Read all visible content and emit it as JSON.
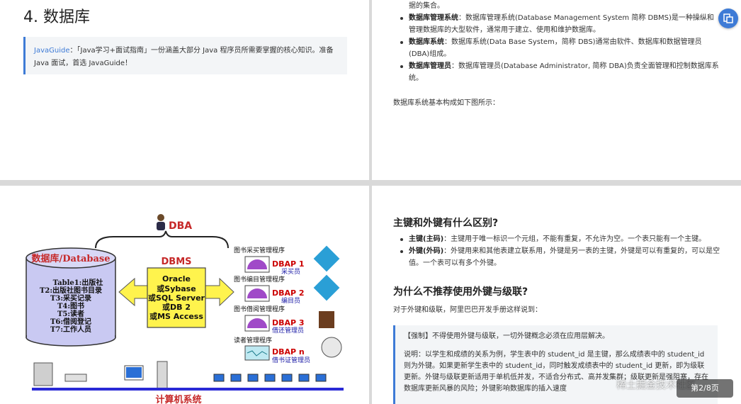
{
  "page1": {
    "title": "4. 数据库",
    "tip_link": "JavaGuide",
    "tip_text": "：「Java学习+面试指南」一份涵盖大部分 Java 程序员所需要掌握的核心知识。准备 Java 面试，首选 JavaGuide！"
  },
  "page2": {
    "top_fragment": "据的集合。",
    "items": [
      {
        "term": "数据库管理系统",
        "text": "：数据库管理系统(Database Management System 简称 DBMS)是一种操纵和管理数据库的大型软件，通常用于建立、使用和维护数据库。"
      },
      {
        "term": "数据库系统",
        "text": "：数据库系统(Data Base System，简称 DBS)通常由软件、数据库和数据管理员(DBA)组成。"
      },
      {
        "term": "数据库管理员",
        "text": "：数据库管理员(Database Administrator, 简称 DBA)负责全面管理和控制数据库系统。"
      }
    ],
    "footer_text": "数据库系统基本构成如下图所示："
  },
  "diagram": {
    "dba_label": "DBA",
    "db_title": "数据库/Database",
    "tables": [
      "Table1:出版社",
      "T2:出版社图书目录",
      "T3:采买记录",
      "T4:图书",
      "T5:读者",
      "T6:借阅登记",
      "T7:工作人员"
    ],
    "dbms_label": "DBMS",
    "dbms_items": [
      "Oracle",
      "或Sybase",
      "或SQL Server",
      "或DB 2",
      "或MS Access"
    ],
    "apps": [
      {
        "program": "图书采买管理程序",
        "name": "DBAP 1",
        "role": "采买员"
      },
      {
        "program": "图书编目管理程序",
        "name": "DBAP 2",
        "role": "编目员"
      },
      {
        "program": "图书借阅管理程序",
        "name": "DBAP 3",
        "role": "借还管理员"
      },
      {
        "program": "读者管理程序",
        "name": "DBAP n",
        "role": "借书证管理员"
      }
    ],
    "bottom_label": "计算机系统"
  },
  "page4": {
    "heading1": "主键和外键有什么区别?",
    "items": [
      {
        "term": "主键(主码)",
        "text": "：主键用于唯一标识一个元组，不能有重复，不允许为空。一个表只能有一个主键。"
      },
      {
        "term": "外键(外码)",
        "text": "：外键用来和其他表建立联系用，外键是另一表的主键，外键是可以有重复的，可以是空值。一个表可以有多个外键。"
      }
    ],
    "heading2": "为什么不推荐使用外键与级联?",
    "intro": "对于外键和级联，阿里巴巴开发手册这样说到：",
    "quote_p1": "【强制】不得使用外键与级联，一切外键概念必须在应用层解决。",
    "quote_p2": "说明：以学生和成绩的关系为例，学生表中的 student_id 是主键，那么成绩表中的 student_id 则为外键。如果更新学生表中的 student_id，同时触发成绩表中的 student_id 更新，即为级联更新。外键与级联更新适用于单机低并发，不适合分布式、高并发集群；级联更新是强阻塞，存在数据库更新风暴的风险；外键影响数据库的插入速度"
  },
  "overlay": {
    "watermark": "稀土掘金技术社区",
    "page_badge": "第2/8页"
  },
  "colors": {
    "accent": "#3e7bd6",
    "dbms_box": "#fff34d",
    "db_cylinder": "#c9c9f2",
    "dbap_text": "#cc0000",
    "role_text": "#1a1aa6"
  }
}
